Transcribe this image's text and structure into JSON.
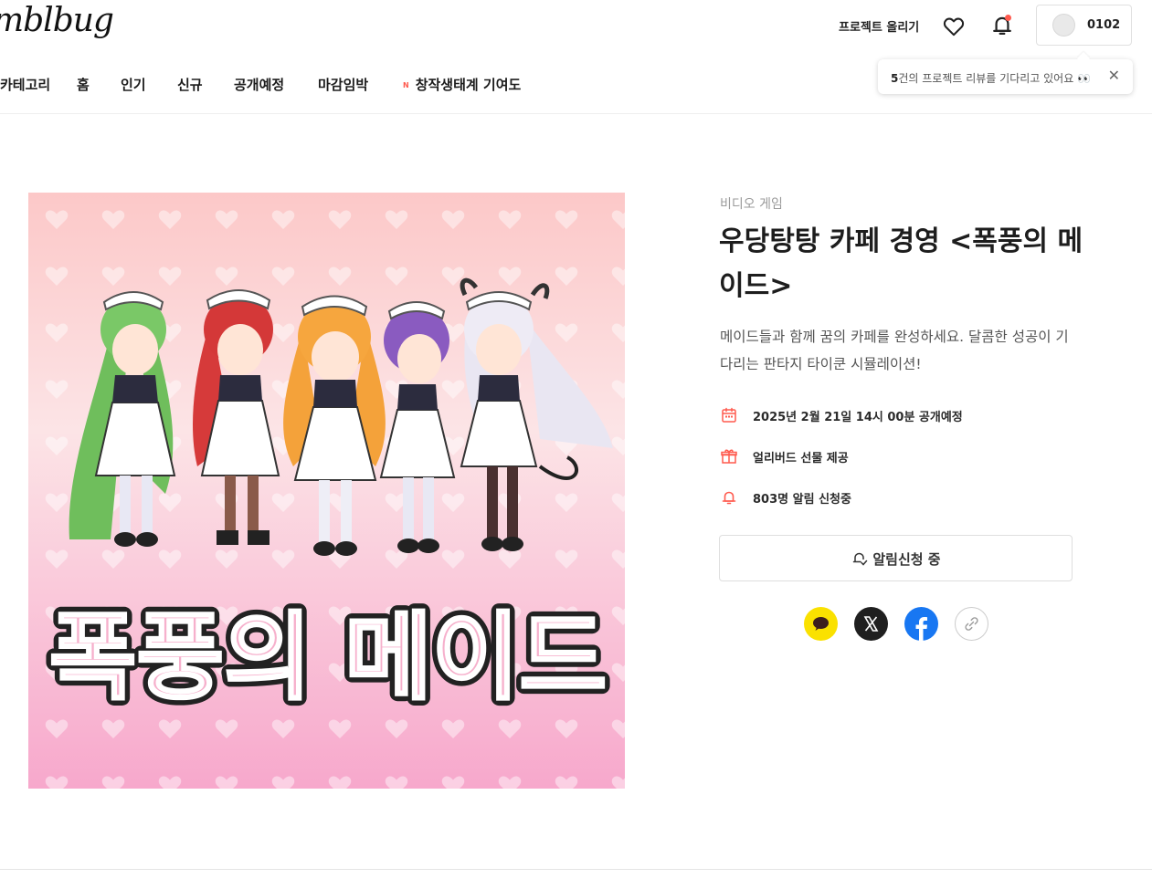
{
  "header": {
    "logo": "mblbug",
    "upload_label": "프로젝트 올리기",
    "profile_name": "0102",
    "icons": {
      "heart": "heart-icon",
      "bell": "bell-icon"
    },
    "tooltip": {
      "count": "5",
      "text": "건의 프로젝트 리뷰를 기다리고 있어요 👀",
      "close": "✕"
    }
  },
  "nav": {
    "items": [
      "카테고리",
      "홈",
      "인기",
      "신규",
      "공개예정",
      "마감임박",
      "창작생태계 기여도"
    ],
    "badge": "N"
  },
  "project": {
    "image_title": "폭풍의 메이드",
    "category": "비디오 게임",
    "title": "우당탕탕 카페 경영 <폭풍의 메이드>",
    "description": "메이드들과 함께 꿈의 카페를 완성하세요. 달콤한 성공이 기다리는 판타지 타이쿤 시뮬레이션!",
    "info": {
      "date": "2025년 2월 21일 14시 00분 공개예정",
      "gift": "얼리버드 선물 제공",
      "alarm": "803명 알림 신청중"
    },
    "notify_label": "알림신청 중",
    "share": [
      "kakao-icon",
      "x-icon",
      "facebook-icon",
      "link-icon"
    ]
  },
  "colors": {
    "accent": "#ff5a4e",
    "kakao": "#fae100",
    "facebook": "#1877f2"
  }
}
